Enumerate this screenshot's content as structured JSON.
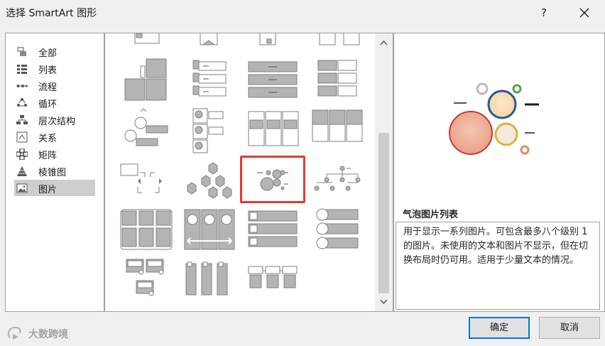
{
  "dialog": {
    "title": "选择 SmartArt 图形",
    "help_label": "?",
    "close_icon": "close-icon"
  },
  "categories": [
    {
      "label": "全部",
      "icon": "all-icon"
    },
    {
      "label": "列表",
      "icon": "list-icon"
    },
    {
      "label": "流程",
      "icon": "process-icon"
    },
    {
      "label": "循环",
      "icon": "cycle-icon"
    },
    {
      "label": "层次结构",
      "icon": "hierarchy-icon"
    },
    {
      "label": "关系",
      "icon": "relationship-icon"
    },
    {
      "label": "矩阵",
      "icon": "matrix-icon"
    },
    {
      "label": "棱锥图",
      "icon": "pyramid-icon"
    },
    {
      "label": "图片",
      "icon": "picture-icon",
      "selected": true
    }
  ],
  "preview": {
    "name": "气泡图片列表",
    "description": "用于显示一系列图片。可包含最多八个级别 1 的图片。未使用的文本和图片不显示，但在切换布局时仍可用。适用于少量文本的情况。"
  },
  "buttons": {
    "ok": "确定",
    "cancel": "取消"
  },
  "watermark": {
    "text": "大数跨境"
  },
  "colors": {
    "selection_outline": "#e23a33",
    "default_button_border": "#0078d7",
    "thumbnail_fill": "#b4b4b4",
    "thumbnail_stroke": "#7f7f7f"
  }
}
